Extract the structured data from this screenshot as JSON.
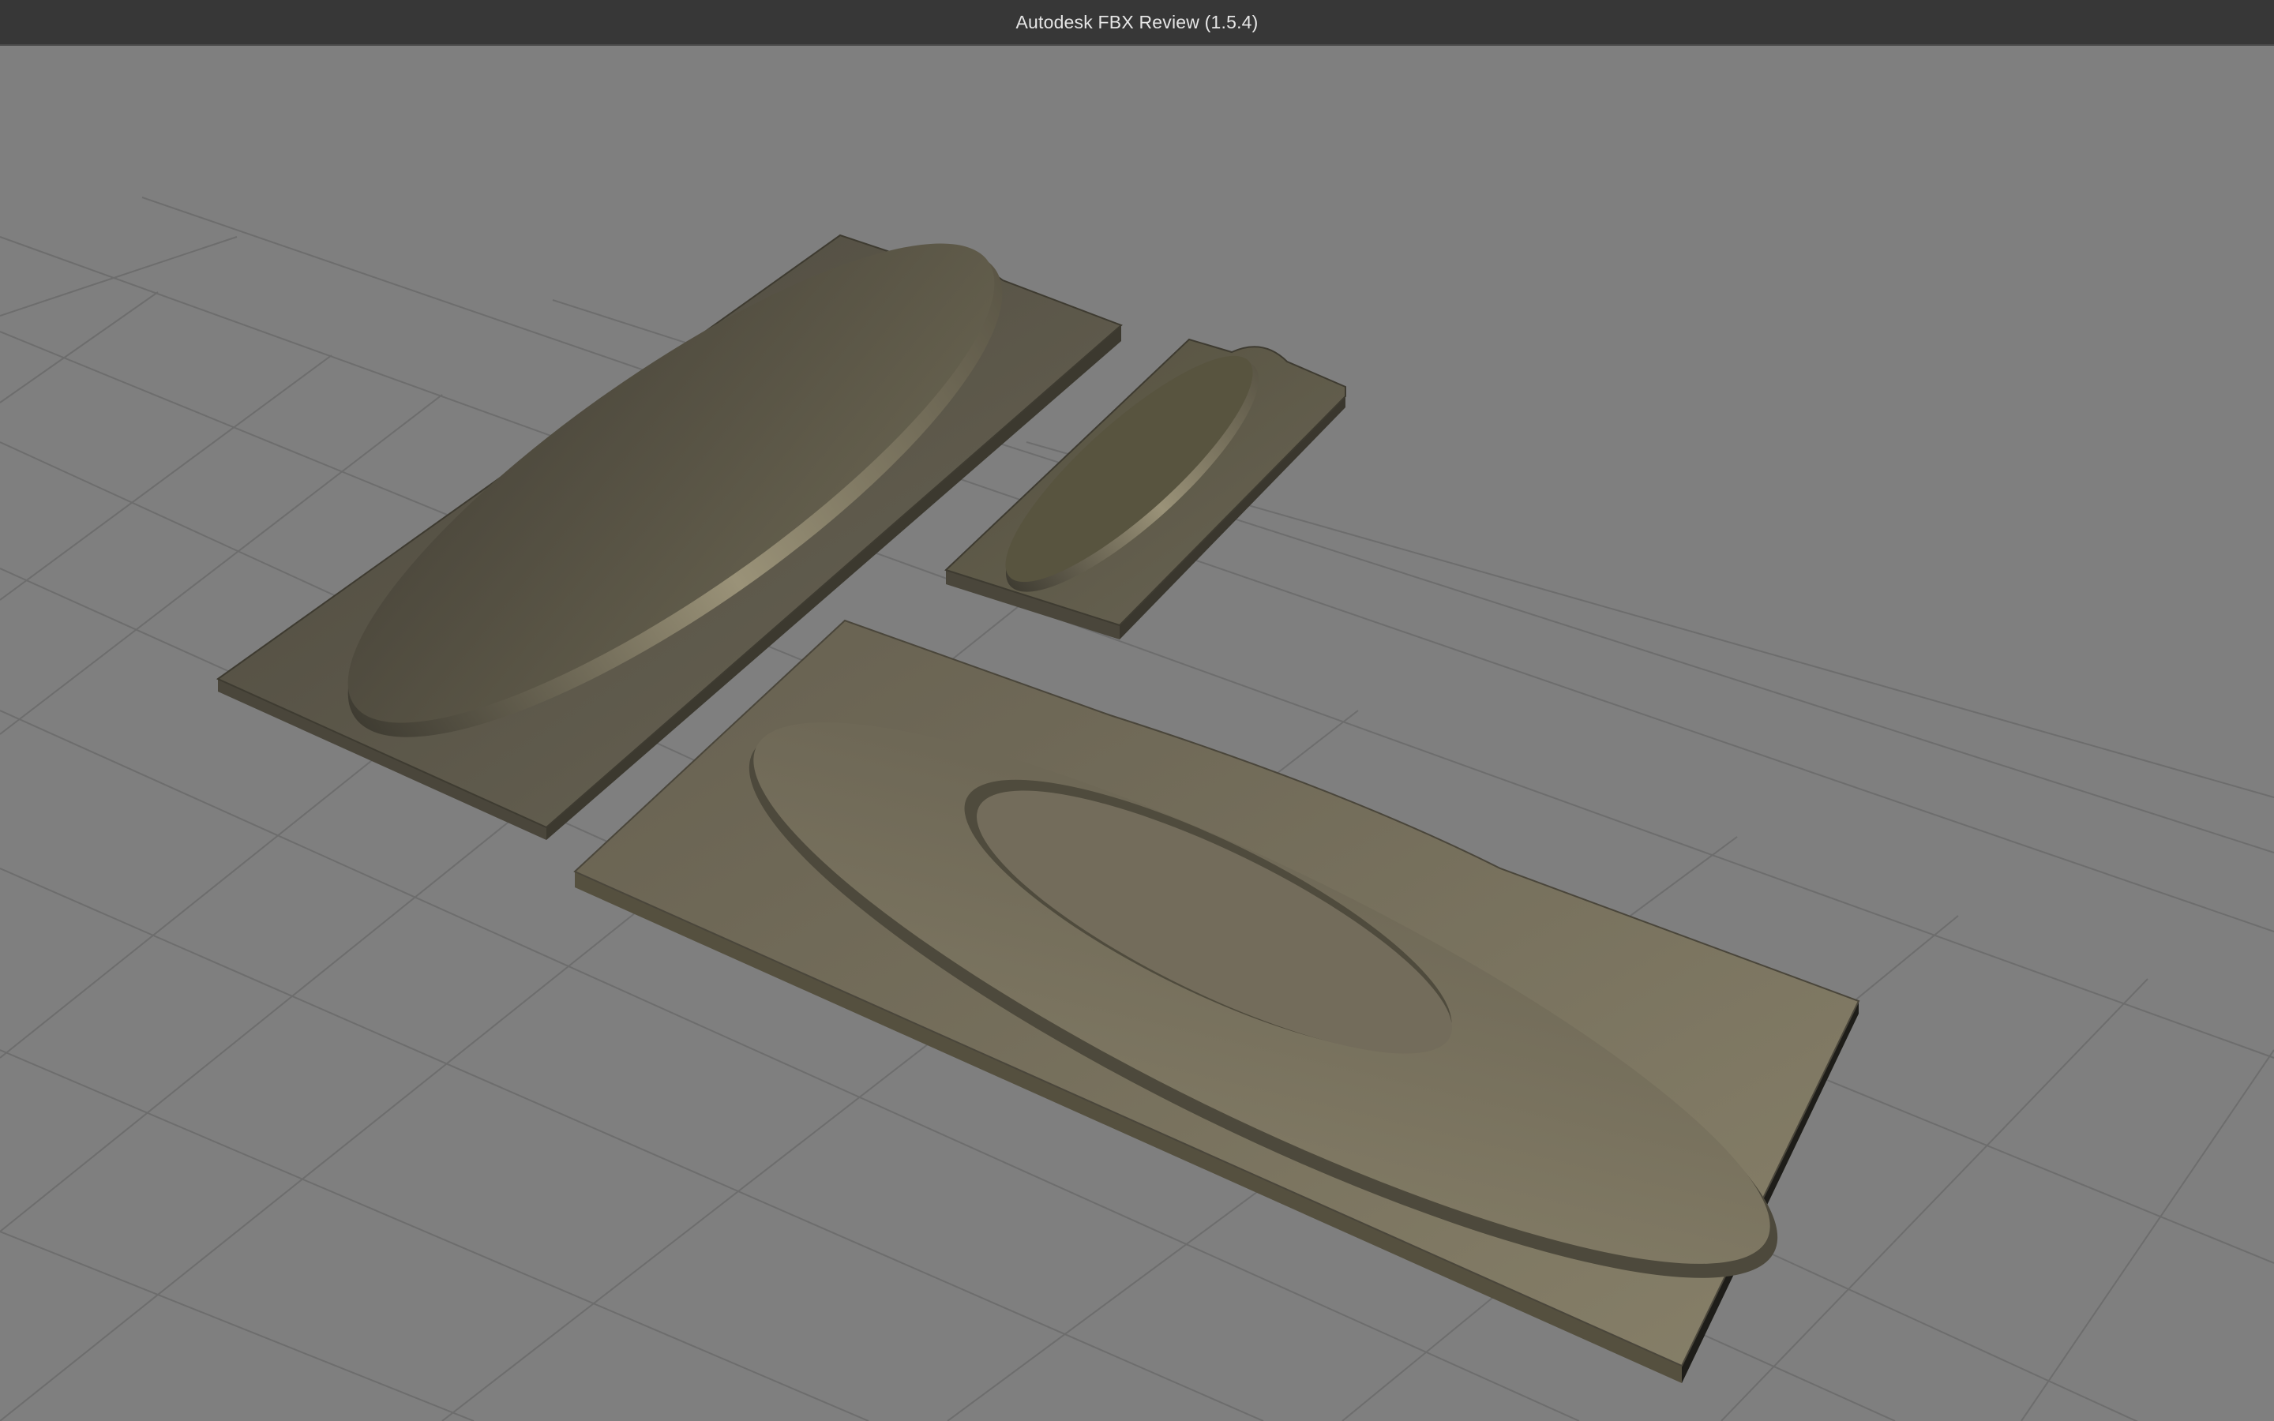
{
  "window": {
    "title": "Autodesk FBX Review (1.5.4)"
  },
  "viewport": {
    "background_color": "#7f7f7f",
    "grid_color": "#6a6a6a",
    "grid_visible": true,
    "models": [
      {
        "name": "large-plate-raised-oval",
        "color": "#6b6656"
      },
      {
        "name": "small-plate-raised-oval",
        "color": "#5f5b4d"
      },
      {
        "name": "large-plate-recessed-oval",
        "color": "#7a7362"
      }
    ]
  }
}
